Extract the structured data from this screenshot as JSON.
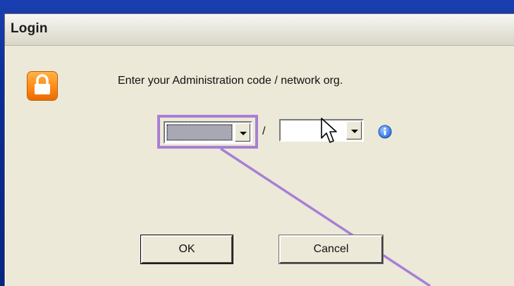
{
  "window": {
    "title": "Login"
  },
  "icons": {
    "dialog": "lock-icon",
    "info": "info-icon",
    "cursor": "arrow-cursor-icon"
  },
  "prompt": {
    "message": "Enter your Administration code / network org."
  },
  "form": {
    "admin_code_value": "",
    "separator": "/",
    "network_org_value": ""
  },
  "buttons": {
    "ok_label": "OK",
    "cancel_label": "Cancel"
  },
  "colors": {
    "highlight": "#a77fd6",
    "lock_orange": "#ff8a1a",
    "info_blue": "#2f6fe0"
  }
}
